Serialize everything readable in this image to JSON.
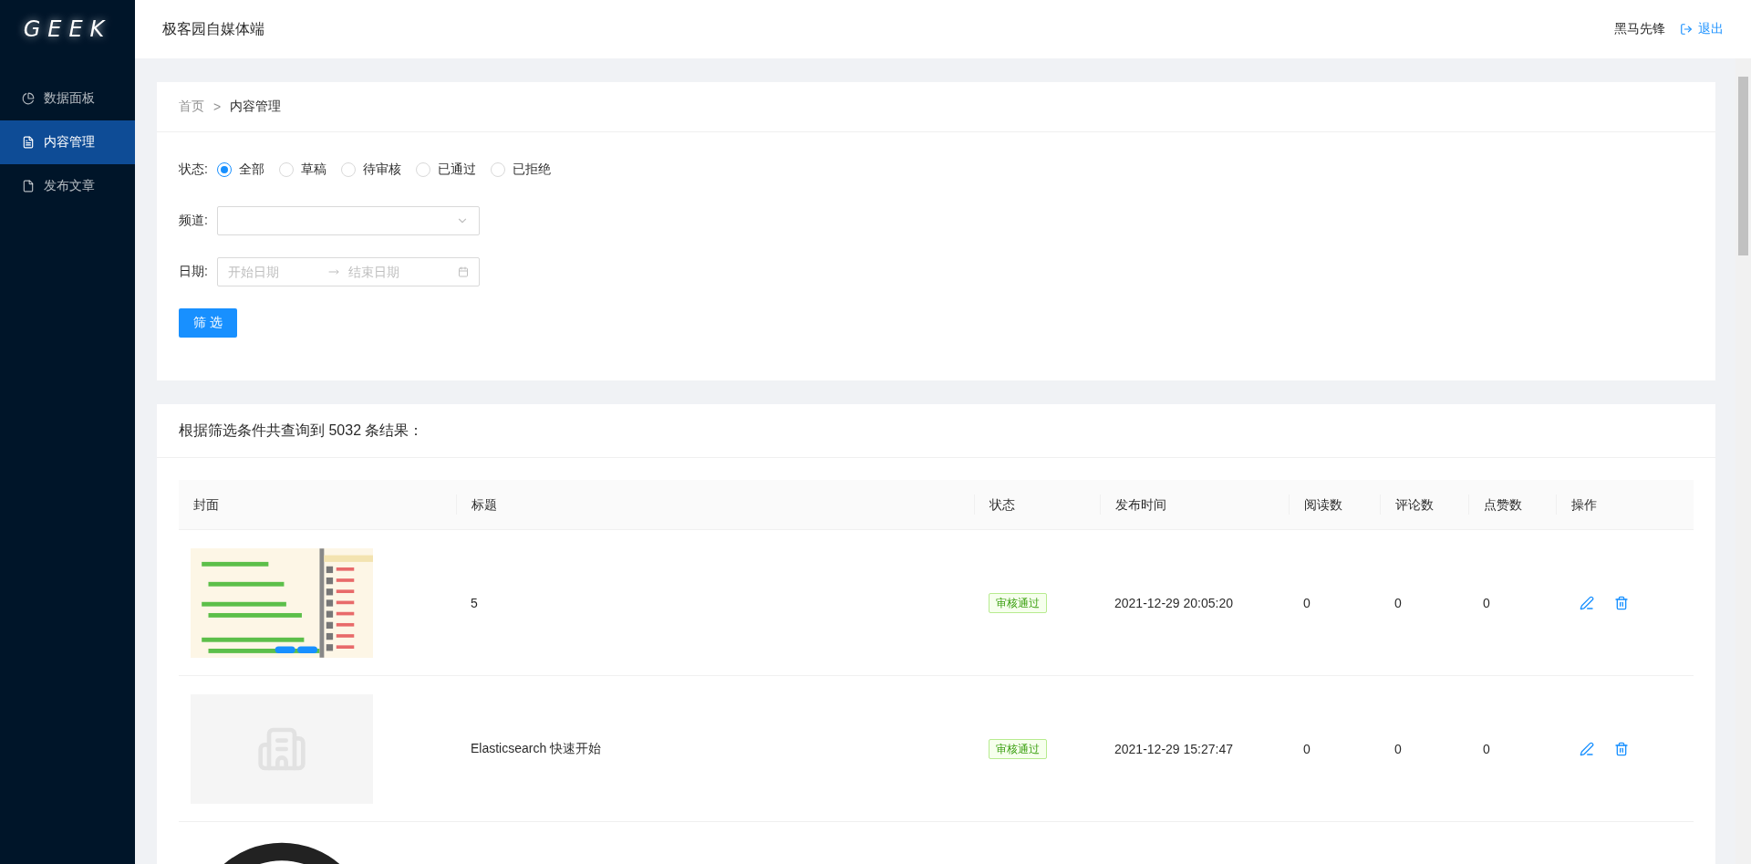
{
  "sidebar": {
    "logo": "GEEK",
    "items": [
      {
        "label": "数据面板",
        "kind": "chart",
        "selected": false
      },
      {
        "label": "内容管理",
        "kind": "list",
        "selected": true
      },
      {
        "label": "发布文章",
        "kind": "file",
        "selected": false
      }
    ]
  },
  "header": {
    "title": "极客园自媒体端",
    "user": "黑马先锋",
    "logout": "退出"
  },
  "breadcrumb": {
    "separator": ">",
    "items": [
      "首页",
      "内容管理"
    ]
  },
  "filter": {
    "status": {
      "label": "状态:",
      "options": [
        {
          "label": "全部",
          "selected": true
        },
        {
          "label": "草稿",
          "selected": false
        },
        {
          "label": "待审核",
          "selected": false
        },
        {
          "label": "已通过",
          "selected": false
        },
        {
          "label": "已拒绝",
          "selected": false
        }
      ]
    },
    "channel": {
      "label": "频道:"
    },
    "date": {
      "label": "日期:",
      "start_placeholder": "开始日期",
      "end_placeholder": "结束日期"
    },
    "submit": "筛 选"
  },
  "results": {
    "summary": "根据筛选条件共查询到 5032 条结果：",
    "columns": [
      "封面",
      "标题",
      "状态",
      "发布时间",
      "阅读数",
      "评论数",
      "点赞数",
      "操作"
    ],
    "rows": [
      {
        "cover": {
          "kind": "photo"
        },
        "title": "5",
        "status": "审核通过",
        "time": "2021-12-29 20:05:20",
        "reads": "0",
        "comments": "0",
        "likes": "0"
      },
      {
        "cover": {
          "kind": "no-picture"
        },
        "title": "Elasticsearch 快速开始",
        "status": "审核通过",
        "time": "2021-12-29 15:27:47",
        "reads": "0",
        "comments": "0",
        "likes": "0"
      },
      {
        "cover": {
          "kind": "play"
        }
      }
    ]
  }
}
